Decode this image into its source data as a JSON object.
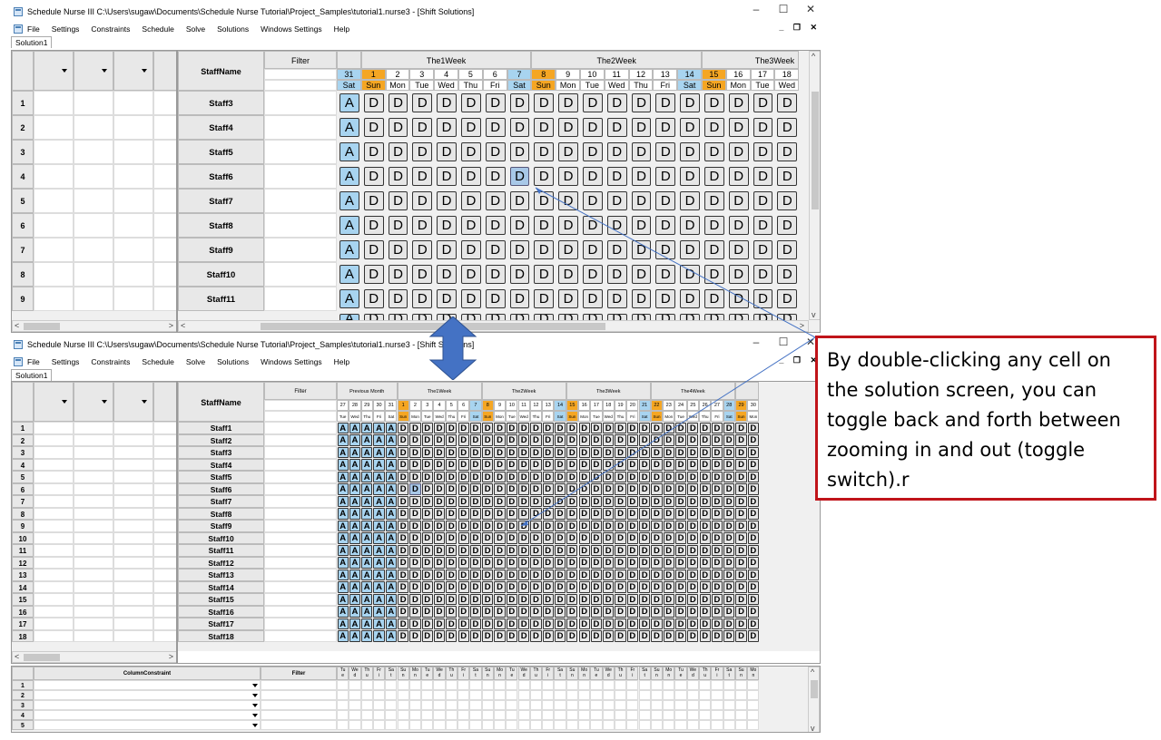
{
  "window_top": {
    "title": "Schedule Nurse III  C:\\Users\\sugaw\\Documents\\Schedule Nurse Tutorial\\Project_Samples\\tutorial1.nurse3 - [Shift Solutions]",
    "controls": {
      "minimize": "–",
      "maximize": "☐",
      "close": "✕"
    },
    "menu": [
      "File",
      "Settings",
      "Constraints",
      "Schedule",
      "Solve",
      "Solutions",
      "Windows Settings",
      "Help"
    ],
    "mdi_controls": "_ ❐ ✕",
    "tab": "Solution1",
    "staffname_header": "StaffName",
    "filter_header": "Filter",
    "weeks": [
      "The1Week",
      "The2Week",
      "The3Week"
    ],
    "days": [
      "31",
      "1",
      "2",
      "3",
      "4",
      "5",
      "6",
      "7",
      "8",
      "9",
      "10",
      "11",
      "12",
      "13",
      "14",
      "15",
      "16",
      "17",
      "18"
    ],
    "daynames": [
      "Sat",
      "Sun",
      "Mon",
      "Tue",
      "Wed",
      "Thu",
      "Fri",
      "Sat",
      "Sun",
      "Mon",
      "Tue",
      "Wed",
      "Thu",
      "Fri",
      "Sat",
      "Sun",
      "Mon",
      "Tue",
      "Wed"
    ],
    "rows": [
      "1",
      "2",
      "3",
      "4",
      "5",
      "6",
      "7",
      "8",
      "9"
    ],
    "staff": [
      "Staff3",
      "Staff4",
      "Staff5",
      "Staff6",
      "Staff7",
      "Staff8",
      "Staff9",
      "Staff10",
      "Staff11"
    ],
    "first_shift": "A",
    "other_shift": "D"
  },
  "window_bottom": {
    "title": "Schedule Nurse III  C:\\Users\\sugaw\\Documents\\Schedule Nurse Tutorial\\Project_Samples\\tutorial1.nurse3 - [Shift Solutions]",
    "menu": [
      "File",
      "Settings",
      "Constraints",
      "Schedule",
      "Solve",
      "Solutions",
      "Windows Settings",
      "Help"
    ],
    "tab": "Solution1",
    "staffname_header": "StaffName",
    "filter_header": "Filter",
    "weeks": [
      "Previous Month",
      "The1Week",
      "The2Week",
      "The3Week",
      "The4Week"
    ],
    "days": [
      "27",
      "28",
      "29",
      "30",
      "31",
      "1",
      "2",
      "3",
      "4",
      "5",
      "6",
      "7",
      "8",
      "9",
      "10",
      "11",
      "12",
      "13",
      "14",
      "15",
      "16",
      "17",
      "18",
      "19",
      "20",
      "21",
      "22",
      "23",
      "24",
      "25",
      "26",
      "27",
      "28",
      "29",
      "30"
    ],
    "daynames": [
      "Tue",
      "Wed",
      "Thu",
      "Fri",
      "Sat",
      "Sun",
      "Mon",
      "Tue",
      "Wed",
      "Thu",
      "Fri",
      "Sat",
      "Sun",
      "Mon",
      "Tue",
      "Wed",
      "Thu",
      "Fri",
      "Sat",
      "Sun",
      "Mon",
      "Tue",
      "Wed",
      "Thu",
      "Fri",
      "Sat",
      "Sun",
      "Mon",
      "Tue",
      "Wed",
      "Thu",
      "Fri",
      "Sat",
      "Sun",
      "Mon"
    ],
    "rows": [
      "1",
      "2",
      "3",
      "4",
      "5",
      "6",
      "7",
      "8",
      "9",
      "10",
      "11",
      "12",
      "13",
      "14",
      "15",
      "16",
      "17",
      "18"
    ],
    "staff": [
      "Staff1",
      "Staff2",
      "Staff3",
      "Staff4",
      "Staff5",
      "Staff6",
      "Staff7",
      "Staff8",
      "Staff9",
      "Staff10",
      "Staff11",
      "Staff12",
      "Staff13",
      "Staff14",
      "Staff15",
      "Staff16",
      "Staff17",
      "Staff18"
    ],
    "column_constraint_header": "ColumnConstraint",
    "constraint_filter_header": "Filter",
    "constraint_rows": [
      "1",
      "2",
      "3",
      "4",
      "5"
    ],
    "constraint_daynames": [
      "Tu",
      "We",
      "Th",
      "Fr",
      "Sa",
      "Su",
      "Mo",
      "Tu",
      "We",
      "Th",
      "Fr",
      "Sa",
      "Su",
      "Mo",
      "Tu",
      "We",
      "Th",
      "Fr",
      "Sa",
      "Su",
      "Mo",
      "Tu",
      "We",
      "Th",
      "Fr",
      "Sa",
      "Su",
      "Mo",
      "Tu",
      "We",
      "Th",
      "Fr",
      "Sa",
      "Su",
      "Mo"
    ],
    "constraint_daynames2": [
      "e",
      "d",
      "u",
      "i",
      "t",
      "n",
      "n",
      "e",
      "d",
      "u",
      "i",
      "t",
      "n",
      "n",
      "e",
      "d",
      "u",
      "i",
      "t",
      "n",
      "n",
      "e",
      "d",
      "u",
      "i",
      "t",
      "n",
      "n",
      "e",
      "d",
      "u",
      "i",
      "t",
      "n",
      "n"
    ]
  },
  "callout": {
    "text": "By double-clicking any cell on the solution screen, you can toggle back and forth between zooming in and out (toggle switch).r"
  },
  "colors": {
    "sunday": "#f5a623",
    "saturday": "#a8d4f0",
    "callout_border": "#c0141a",
    "arrow": "#4472c4"
  }
}
